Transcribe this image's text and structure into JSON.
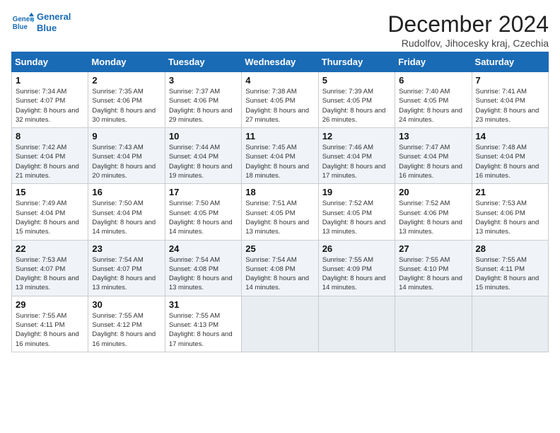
{
  "logo": {
    "line1": "General",
    "line2": "Blue"
  },
  "title": "December 2024",
  "subtitle": "Rudolfov, Jihocesky kraj, Czechia",
  "days_of_week": [
    "Sunday",
    "Monday",
    "Tuesday",
    "Wednesday",
    "Thursday",
    "Friday",
    "Saturday"
  ],
  "weeks": [
    [
      {
        "day": "1",
        "detail": "Sunrise: 7:34 AM\nSunset: 4:07 PM\nDaylight: 8 hours and 32 minutes."
      },
      {
        "day": "2",
        "detail": "Sunrise: 7:35 AM\nSunset: 4:06 PM\nDaylight: 8 hours and 30 minutes."
      },
      {
        "day": "3",
        "detail": "Sunrise: 7:37 AM\nSunset: 4:06 PM\nDaylight: 8 hours and 29 minutes."
      },
      {
        "day": "4",
        "detail": "Sunrise: 7:38 AM\nSunset: 4:05 PM\nDaylight: 8 hours and 27 minutes."
      },
      {
        "day": "5",
        "detail": "Sunrise: 7:39 AM\nSunset: 4:05 PM\nDaylight: 8 hours and 26 minutes."
      },
      {
        "day": "6",
        "detail": "Sunrise: 7:40 AM\nSunset: 4:05 PM\nDaylight: 8 hours and 24 minutes."
      },
      {
        "day": "7",
        "detail": "Sunrise: 7:41 AM\nSunset: 4:04 PM\nDaylight: 8 hours and 23 minutes."
      }
    ],
    [
      {
        "day": "8",
        "detail": "Sunrise: 7:42 AM\nSunset: 4:04 PM\nDaylight: 8 hours and 21 minutes."
      },
      {
        "day": "9",
        "detail": "Sunrise: 7:43 AM\nSunset: 4:04 PM\nDaylight: 8 hours and 20 minutes."
      },
      {
        "day": "10",
        "detail": "Sunrise: 7:44 AM\nSunset: 4:04 PM\nDaylight: 8 hours and 19 minutes."
      },
      {
        "day": "11",
        "detail": "Sunrise: 7:45 AM\nSunset: 4:04 PM\nDaylight: 8 hours and 18 minutes."
      },
      {
        "day": "12",
        "detail": "Sunrise: 7:46 AM\nSunset: 4:04 PM\nDaylight: 8 hours and 17 minutes."
      },
      {
        "day": "13",
        "detail": "Sunrise: 7:47 AM\nSunset: 4:04 PM\nDaylight: 8 hours and 16 minutes."
      },
      {
        "day": "14",
        "detail": "Sunrise: 7:48 AM\nSunset: 4:04 PM\nDaylight: 8 hours and 16 minutes."
      }
    ],
    [
      {
        "day": "15",
        "detail": "Sunrise: 7:49 AM\nSunset: 4:04 PM\nDaylight: 8 hours and 15 minutes."
      },
      {
        "day": "16",
        "detail": "Sunrise: 7:50 AM\nSunset: 4:04 PM\nDaylight: 8 hours and 14 minutes."
      },
      {
        "day": "17",
        "detail": "Sunrise: 7:50 AM\nSunset: 4:05 PM\nDaylight: 8 hours and 14 minutes."
      },
      {
        "day": "18",
        "detail": "Sunrise: 7:51 AM\nSunset: 4:05 PM\nDaylight: 8 hours and 13 minutes."
      },
      {
        "day": "19",
        "detail": "Sunrise: 7:52 AM\nSunset: 4:05 PM\nDaylight: 8 hours and 13 minutes."
      },
      {
        "day": "20",
        "detail": "Sunrise: 7:52 AM\nSunset: 4:06 PM\nDaylight: 8 hours and 13 minutes."
      },
      {
        "day": "21",
        "detail": "Sunrise: 7:53 AM\nSunset: 4:06 PM\nDaylight: 8 hours and 13 minutes."
      }
    ],
    [
      {
        "day": "22",
        "detail": "Sunrise: 7:53 AM\nSunset: 4:07 PM\nDaylight: 8 hours and 13 minutes."
      },
      {
        "day": "23",
        "detail": "Sunrise: 7:54 AM\nSunset: 4:07 PM\nDaylight: 8 hours and 13 minutes."
      },
      {
        "day": "24",
        "detail": "Sunrise: 7:54 AM\nSunset: 4:08 PM\nDaylight: 8 hours and 13 minutes."
      },
      {
        "day": "25",
        "detail": "Sunrise: 7:54 AM\nSunset: 4:08 PM\nDaylight: 8 hours and 14 minutes."
      },
      {
        "day": "26",
        "detail": "Sunrise: 7:55 AM\nSunset: 4:09 PM\nDaylight: 8 hours and 14 minutes."
      },
      {
        "day": "27",
        "detail": "Sunrise: 7:55 AM\nSunset: 4:10 PM\nDaylight: 8 hours and 14 minutes."
      },
      {
        "day": "28",
        "detail": "Sunrise: 7:55 AM\nSunset: 4:11 PM\nDaylight: 8 hours and 15 minutes."
      }
    ],
    [
      {
        "day": "29",
        "detail": "Sunrise: 7:55 AM\nSunset: 4:11 PM\nDaylight: 8 hours and 16 minutes."
      },
      {
        "day": "30",
        "detail": "Sunrise: 7:55 AM\nSunset: 4:12 PM\nDaylight: 8 hours and 16 minutes."
      },
      {
        "day": "31",
        "detail": "Sunrise: 7:55 AM\nSunset: 4:13 PM\nDaylight: 8 hours and 17 minutes."
      },
      null,
      null,
      null,
      null
    ]
  ]
}
